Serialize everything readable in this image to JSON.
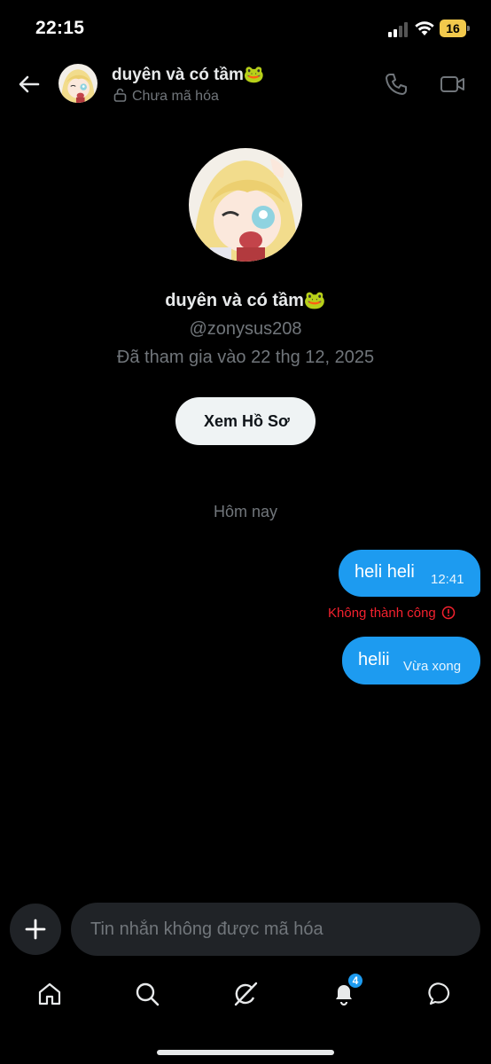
{
  "status_bar": {
    "time": "22:15",
    "battery_level": "16",
    "battery_color": "#f2c94c"
  },
  "header": {
    "name": "duyên và có tầm🐸",
    "encryption_status": "Chưa mã hóa",
    "icons": {
      "back": "back-arrow-icon",
      "lock": "unlock-icon",
      "call": "phone-icon",
      "video": "video-camera-icon"
    }
  },
  "profile": {
    "name": "duyên và có tầm🐸",
    "handle": "@zonysus208",
    "joined": "Đã tham gia vào 22 thg 12, 2025",
    "view_profile_label": "Xem Hồ Sơ"
  },
  "conversation": {
    "date_divider": "Hôm nay",
    "messages": [
      {
        "text": "heli heli",
        "time": "12:41",
        "status": "Không thành công",
        "status_color": "#f4212e"
      },
      {
        "text": "helii",
        "time": "Vừa xong"
      }
    ],
    "bubble_color": "#1d9bf0"
  },
  "composer": {
    "placeholder": "Tin nhắn không được mã hóa",
    "add_icon": "plus-icon"
  },
  "bottom_nav": {
    "items": [
      {
        "icon": "home-icon"
      },
      {
        "icon": "search-icon"
      },
      {
        "icon": "grok-icon"
      },
      {
        "icon": "bell-icon",
        "badge": "4"
      },
      {
        "icon": "chat-bubble-icon"
      }
    ]
  },
  "colors": {
    "background": "#000000",
    "accent": "#1d9bf0",
    "muted_text": "#71767b",
    "error": "#f4212e"
  }
}
